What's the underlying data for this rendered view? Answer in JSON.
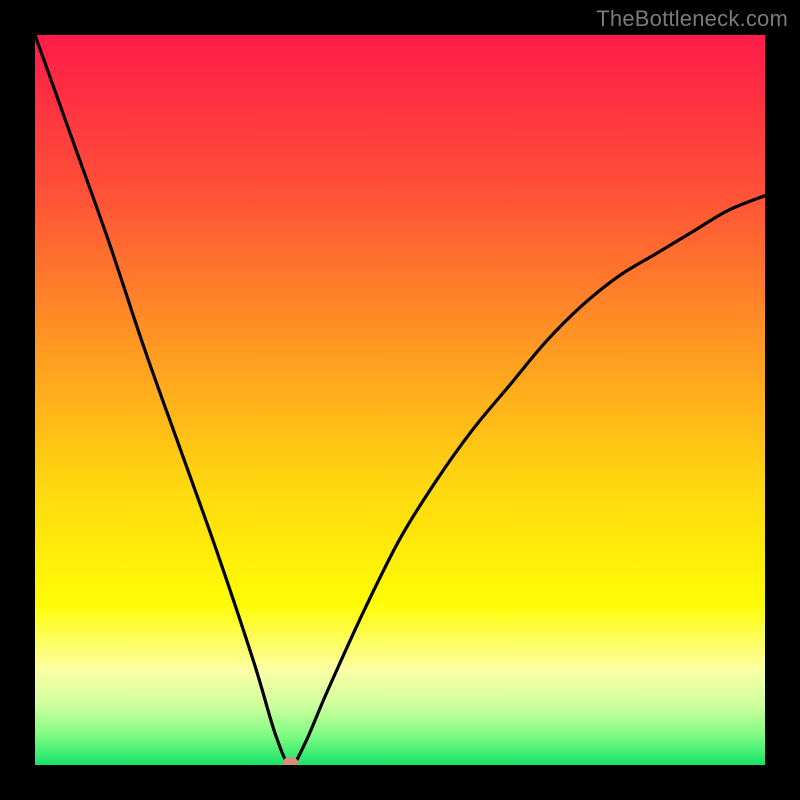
{
  "watermark": "TheBottleneck.com",
  "chart_data": {
    "type": "line",
    "title": "",
    "xlabel": "",
    "ylabel": "",
    "xlim": [
      0,
      100
    ],
    "ylim": [
      0,
      100
    ],
    "minimum_marker": {
      "x": 35,
      "y": 0
    },
    "series": [
      {
        "name": "curve",
        "x": [
          0,
          5,
          10,
          15,
          20,
          25,
          30,
          33,
          35,
          37,
          40,
          45,
          50,
          55,
          60,
          65,
          70,
          75,
          80,
          85,
          90,
          95,
          100
        ],
        "y": [
          100,
          86,
          72,
          57,
          43,
          29,
          14,
          4,
          0,
          3,
          10,
          21,
          31,
          39,
          46,
          52,
          58,
          63,
          67,
          70,
          73,
          76,
          78
        ]
      }
    ],
    "background_gradient": {
      "stops": [
        {
          "offset": 0.0,
          "color": "#ff1b49"
        },
        {
          "offset": 0.22,
          "color": "#ff5237"
        },
        {
          "offset": 0.43,
          "color": "#ff9a22"
        },
        {
          "offset": 0.62,
          "color": "#ffd80f"
        },
        {
          "offset": 0.78,
          "color": "#fffc06"
        },
        {
          "offset": 0.87,
          "color": "#fbffa5"
        },
        {
          "offset": 0.92,
          "color": "#ccff9d"
        },
        {
          "offset": 0.96,
          "color": "#7dfb82"
        },
        {
          "offset": 1.0,
          "color": "#17e36a"
        }
      ]
    }
  }
}
